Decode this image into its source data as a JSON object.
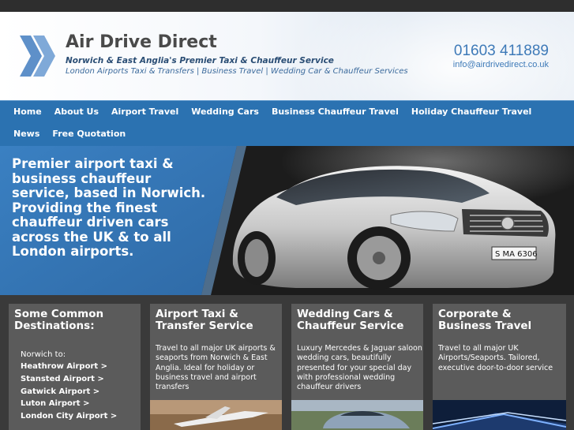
{
  "header": {
    "brand": "Air Drive Direct",
    "tagline": "Norwich & East Anglia's Premier Taxi & Chauffeur Service",
    "services": "London Airports Taxi & Transfers | Business Travel | Wedding Car & Chauffeur Services",
    "phone": "01603 411889",
    "email": "info@airdrivedirect.co.uk",
    "logo_icon": "double-chevron-icon"
  },
  "nav": {
    "items": [
      "Home",
      "About Us",
      "Airport Travel",
      "Wedding Cars",
      "Business Chauffeur Travel",
      "Holiday Chauffeur Travel",
      "News",
      "Free Quotation"
    ]
  },
  "hero": {
    "text": "Premier airport taxi & business chauffeur service, based in Norwich. Providing the finest chauffeur driven cars across the UK & to all London airports.",
    "plate": "S MA 6306"
  },
  "boxes": {
    "destinations": {
      "title": "Some Common Destinations:",
      "label": "Norwich to:",
      "links": [
        "Heathrow Airport >",
        "Stansted Airport >",
        "Gatwick Airport >",
        "Luton Airport >",
        "London City Airport >"
      ]
    },
    "airport": {
      "title": "Airport Taxi & Transfer Service",
      "text": "Travel to all major UK airports & seaports from Norwich & East Anglia. Ideal for holiday or business travel and airport transfers"
    },
    "wedding": {
      "title": "Wedding Cars & Chauffeur Service",
      "text": "Luxury Mercedes & Jaguar saloon wedding cars, beautifully presented for your special day with professional wedding chauffeur drivers"
    },
    "corporate": {
      "title": "Corporate & Business Travel",
      "text": "Travel to all major UK Airports/Seaports. Tailored, executive door-to-door service"
    }
  },
  "colors": {
    "nav": "#2b72b1",
    "hero_blue": "#3b7fc0",
    "box": "#5b5b5b",
    "page_bg": "#3a3a3a",
    "brand_text": "#4a4a4a",
    "contact_text": "#3e7ab8"
  }
}
